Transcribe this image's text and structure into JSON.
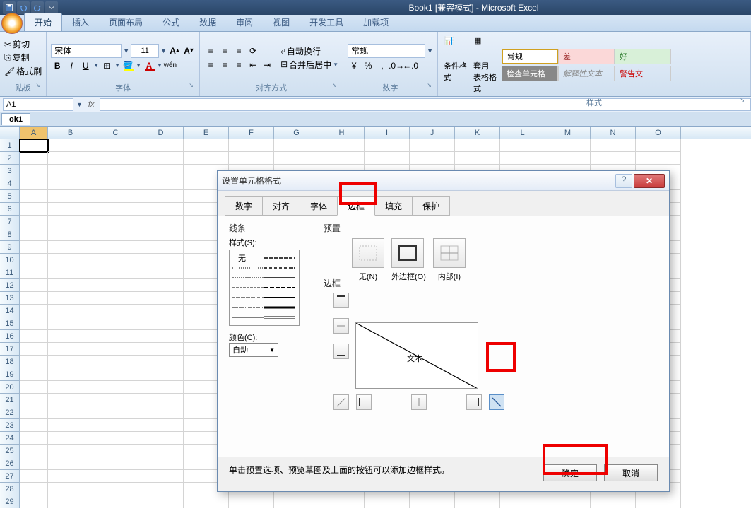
{
  "titlebar": {
    "title": "Book1 [兼容模式] - Microsoft Excel"
  },
  "ribbon_tabs": [
    "开始",
    "插入",
    "页面布局",
    "公式",
    "数据",
    "审阅",
    "视图",
    "开发工具",
    "加载项"
  ],
  "clipboard": {
    "cut": "剪切",
    "copy": "复制",
    "painter": "格式刷",
    "group": "贴板"
  },
  "font": {
    "name": "宋体",
    "size": "11",
    "group": "字体"
  },
  "align": {
    "wrap": "自动换行",
    "merge": "合并后居中",
    "group": "对齐方式"
  },
  "number": {
    "format": "常规",
    "group": "数字"
  },
  "styles": {
    "cond": "条件格式",
    "table": "套用\n表格格式",
    "normal": "常规",
    "bad": "差",
    "good": "好",
    "check": "检查单元格",
    "explain": "解释性文本",
    "warn": "警告文",
    "group": "样式"
  },
  "formula_bar": {
    "cell": "A1",
    "fx": "fx"
  },
  "workbook_tab": "ok1",
  "columns": [
    "A",
    "B",
    "C",
    "D",
    "E",
    "F",
    "G",
    "H",
    "I",
    "J",
    "K",
    "L",
    "M",
    "N",
    "O"
  ],
  "row_count": 29,
  "dialog": {
    "title": "设置单元格格式",
    "tabs": [
      "数字",
      "对齐",
      "字体",
      "边框",
      "填充",
      "保护"
    ],
    "active_tab": 3,
    "line_label": "线条",
    "style_label": "样式(S):",
    "none": "无",
    "color_label": "颜色(C):",
    "color_value": "自动",
    "preset_label": "预置",
    "presets": {
      "none": "无(N)",
      "outer": "外边框(O)",
      "inner": "内部(I)"
    },
    "border_label": "边框",
    "preview_text": "文本",
    "hint": "单击预置选项、预览草图及上面的按钮可以添加边框样式。",
    "ok": "确定",
    "cancel": "取消"
  }
}
